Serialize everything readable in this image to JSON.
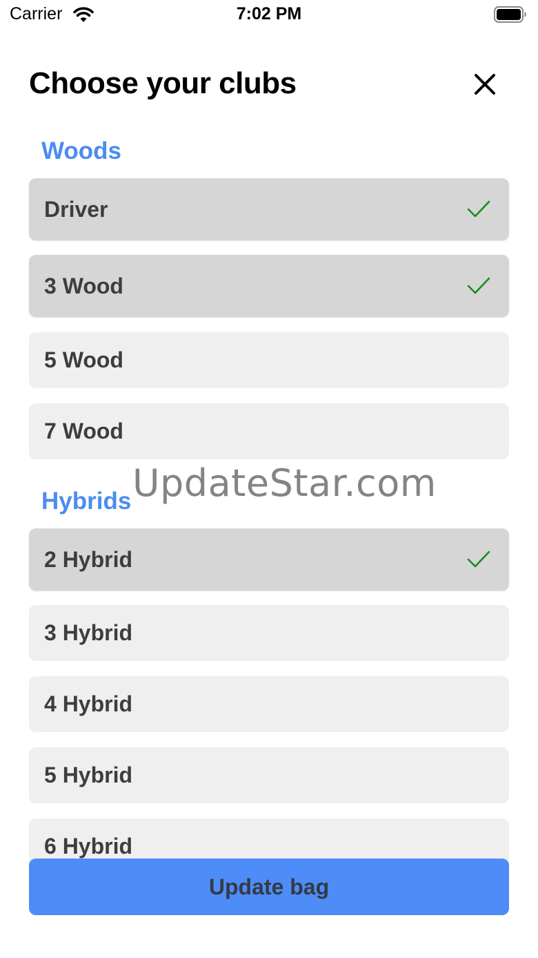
{
  "status_bar": {
    "carrier": "Carrier",
    "time": "7:02 PM"
  },
  "header": {
    "title": "Choose your clubs"
  },
  "sections": [
    {
      "title": "Woods",
      "items": [
        {
          "label": "Driver",
          "selected": true
        },
        {
          "label": "3 Wood",
          "selected": true
        },
        {
          "label": "5 Wood",
          "selected": false
        },
        {
          "label": "7 Wood",
          "selected": false
        }
      ]
    },
    {
      "title": "Hybrids",
      "items": [
        {
          "label": "2 Hybrid",
          "selected": true
        },
        {
          "label": "3 Hybrid",
          "selected": false
        },
        {
          "label": "4 Hybrid",
          "selected": false
        },
        {
          "label": "5 Hybrid",
          "selected": false
        },
        {
          "label": "6 Hybrid",
          "selected": false
        }
      ]
    }
  ],
  "watermark": "UpdateStar.com",
  "footer": {
    "button_label": "Update bag"
  },
  "colors": {
    "accent": "#4e8cf7",
    "section_title": "#4b8cf0",
    "check": "#1a8a1a",
    "row_selected": "#d6d6d6",
    "row_default": "#efefef"
  },
  "icons": {
    "close": "close-icon",
    "check": "checkmark-icon",
    "wifi": "wifi-icon",
    "battery": "battery-icon"
  }
}
